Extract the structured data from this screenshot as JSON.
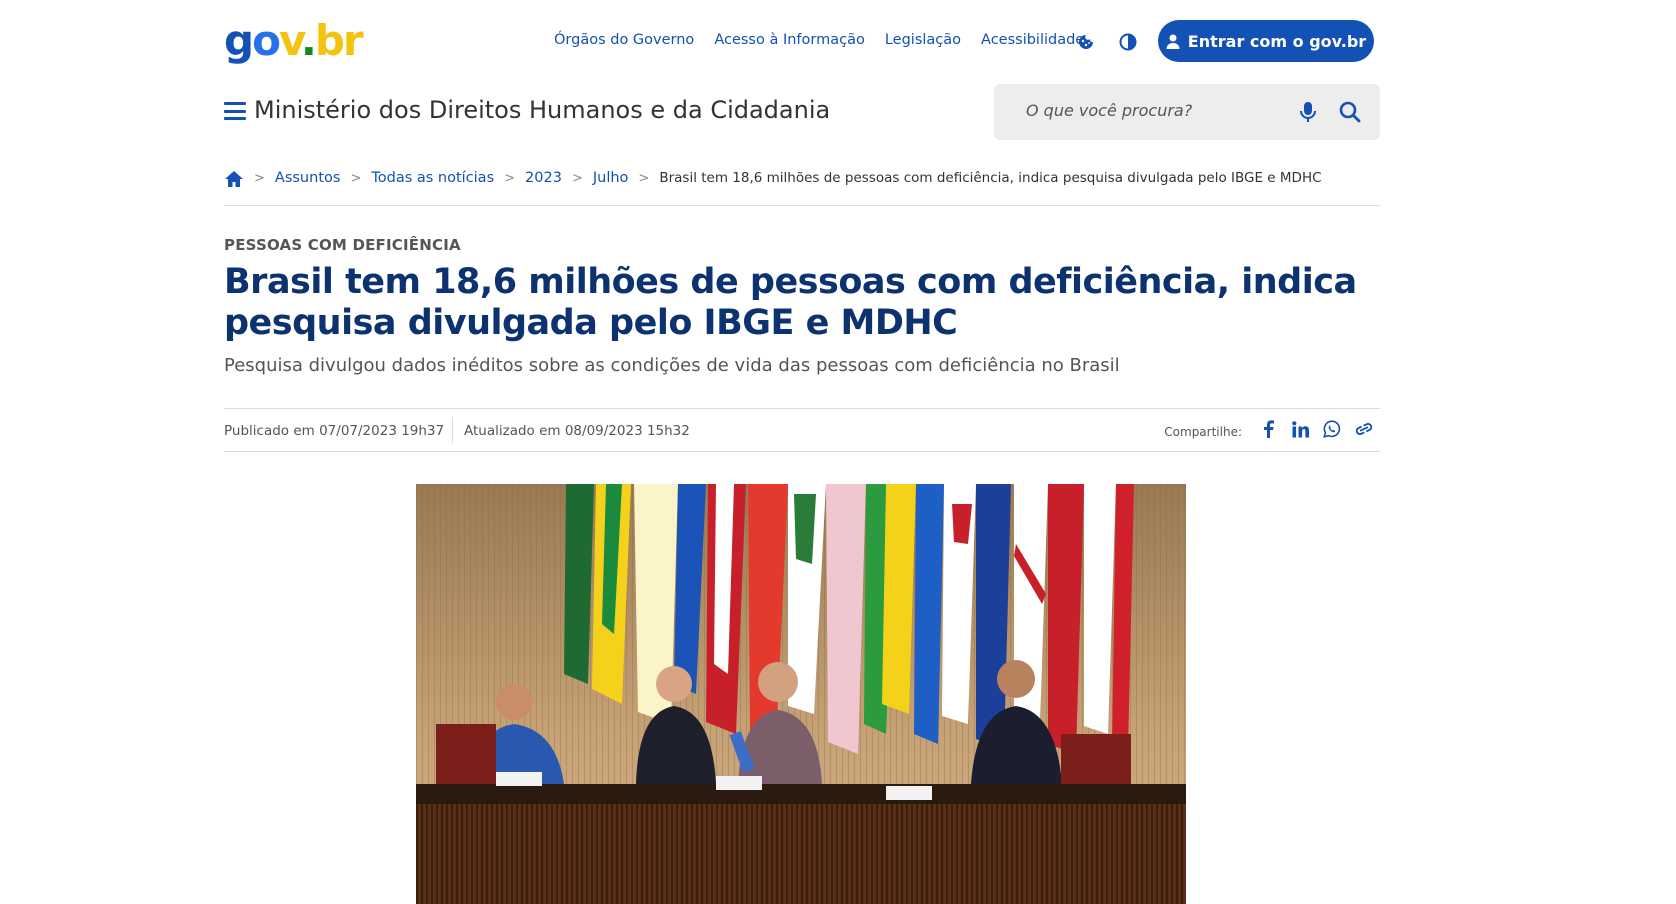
{
  "header": {
    "logo_text": "gov.br",
    "links": [
      "Órgãos do Governo",
      "Acesso à Informação",
      "Legislação",
      "Acessibilidade"
    ],
    "icons": [
      "cookie-icon",
      "contrast-icon"
    ],
    "login_label": "Entrar com o gov.br",
    "site_title": "Ministério dos Direitos Humanos e da Cidadania",
    "search_placeholder": "O que você procura?"
  },
  "breadcrumb": {
    "items": [
      "Assuntos",
      "Todas as notícias",
      "2023",
      "Julho"
    ],
    "current": "Brasil tem 18,6 milhões de pessoas com deficiência, indica pesquisa divulgada pelo IBGE e MDHC"
  },
  "article": {
    "category": "PESSOAS COM DEFICIÊNCIA",
    "title": "Brasil tem 18,6 milhões de pessoas com deficiência, indica pesquisa divulgada pelo IBGE e MDHC",
    "subtitle": "Pesquisa divulgou dados inéditos sobre as condições de vida das pessoas com deficiência no Brasil",
    "published": "Publicado em 07/07/2023 19h37",
    "updated": "Atualizado em 08/09/2023 15h32",
    "share_label": "Compartilhe:",
    "share_icons": [
      "facebook-icon",
      "linkedin-icon",
      "whatsapp-icon",
      "copy-link-icon"
    ]
  },
  "colors": {
    "brand_blue": "#1351b4",
    "headline_blue": "#0c326f",
    "search_bg": "#ededed"
  }
}
